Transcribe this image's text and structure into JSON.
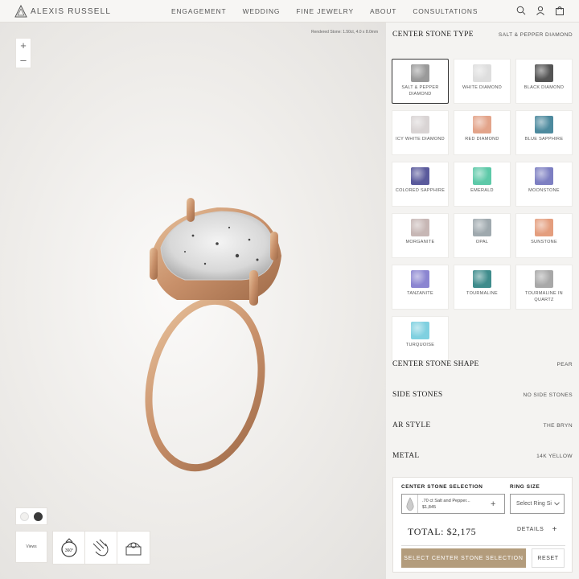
{
  "brand": {
    "name": "ALEXIS RUSSELL"
  },
  "nav": {
    "items": [
      "ENGAGEMENT",
      "WEDDING",
      "FINE JEWELRY",
      "ABOUT",
      "CONSULTATIONS"
    ],
    "icons": [
      "search-icon",
      "account-icon",
      "cart-icon"
    ]
  },
  "viewer": {
    "zoom_in": "+",
    "zoom_out": "–",
    "rendered_note": "Rendered Stone: 1.50ct, 4.0 x 8.0mm",
    "background_swatches": [
      "#f1f0ee",
      "#3a3a3a"
    ],
    "views_label": "Views"
  },
  "panel": {
    "center_stone": {
      "title": "CENTER STONE TYPE",
      "value": "SALT & PEPPER DIAMOND"
    },
    "stones": [
      {
        "name": "SALT & PEPPER DIAMOND",
        "color": "#9a9a9a",
        "selected": true
      },
      {
        "name": "WHITE DIAMOND",
        "color": "#dedede"
      },
      {
        "name": "BLACK DIAMOND",
        "color": "#555555"
      },
      {
        "name": "ICY WHITE DIAMOND",
        "color": "#d9d4d4"
      },
      {
        "name": "RED DIAMOND",
        "color": "#e3a48a"
      },
      {
        "name": "BLUE SAPPHIRE",
        "color": "#4d8a9e"
      },
      {
        "name": "COLORED SAPPHIRE",
        "color": "#5a5a9c"
      },
      {
        "name": "EMERALD",
        "color": "#5dc9a8"
      },
      {
        "name": "MOONSTONE",
        "color": "#7d7fc2"
      },
      {
        "name": "MORGANITE",
        "color": "#c7b7b5"
      },
      {
        "name": "OPAL",
        "color": "#9fa9ae"
      },
      {
        "name": "SUNSTONE",
        "color": "#e49e7e"
      },
      {
        "name": "TANZANITE",
        "color": "#8b85d1"
      },
      {
        "name": "TOURMALINE",
        "color": "#3f8c8c"
      },
      {
        "name": "TOURMALINE IN QUARTZ",
        "color": "#a8a8a8"
      },
      {
        "name": "TURQUOISE",
        "color": "#7fd0e0"
      }
    ],
    "sections": [
      {
        "title": "CENTER STONE SHAPE",
        "value": "PEAR"
      },
      {
        "title": "SIDE STONES",
        "value": "NO SIDE STONES"
      },
      {
        "title": "AR STYLE",
        "value": "THE BRYN"
      },
      {
        "title": "METAL",
        "value": "14K YELLOW"
      }
    ]
  },
  "summary": {
    "selection_label": "CENTER STONE SELECTION",
    "selection_text": ".70 ct Salt and Pepper...",
    "selection_price": "$1,845",
    "ring_size_label": "RING SIZE",
    "ring_size_placeholder": "Select Ring Si",
    "total": "TOTAL: $2,175",
    "details": "DETAILS",
    "cta": "SELECT CENTER STONE SELECTION",
    "reset": "RESET"
  }
}
